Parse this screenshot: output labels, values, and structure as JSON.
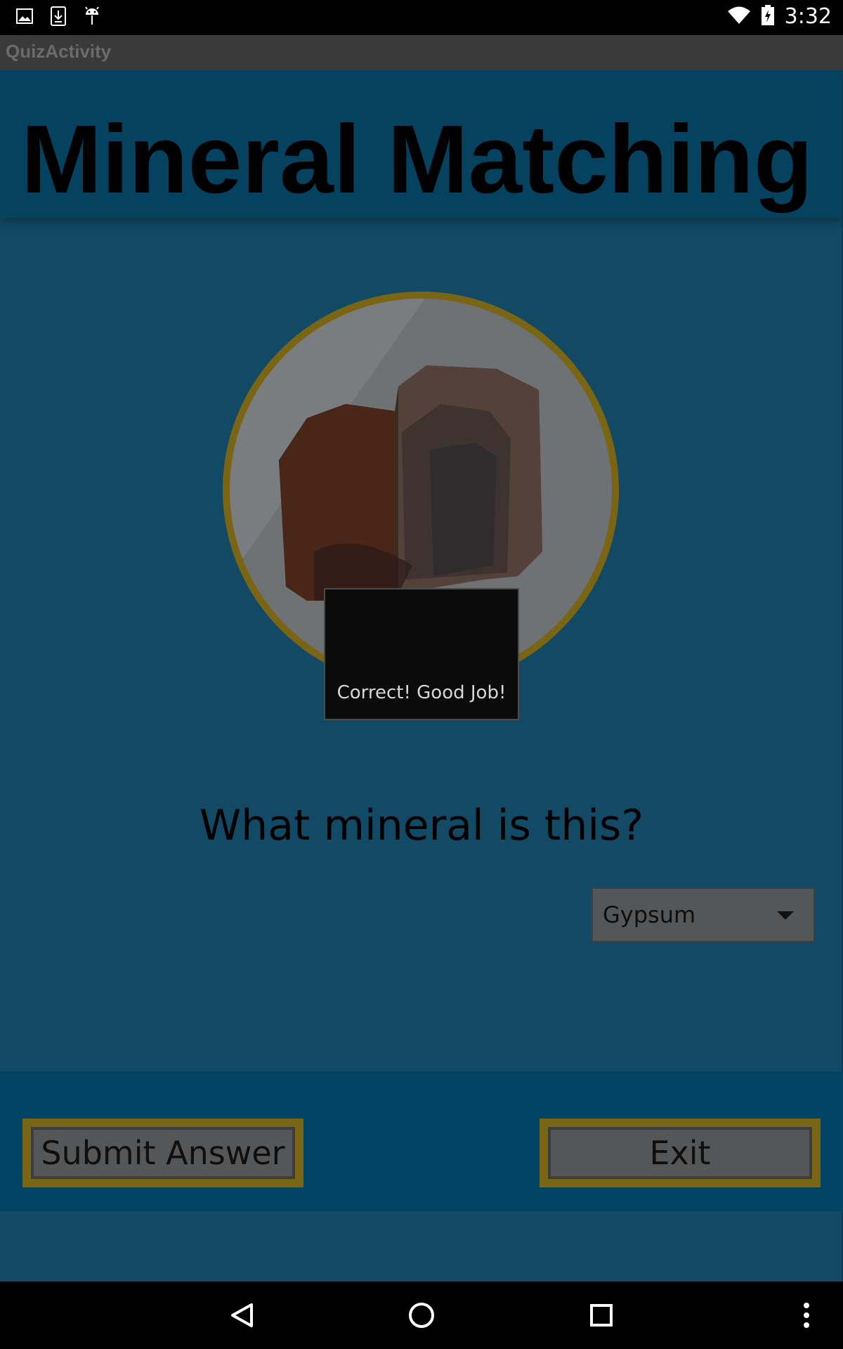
{
  "status_bar": {
    "time": "3:32",
    "left_icons": [
      "image-icon",
      "download-icon",
      "android-icon"
    ],
    "right_icons": [
      "wifi-icon",
      "battery-charging-icon"
    ]
  },
  "title_bar": {
    "title": "QuizActivity"
  },
  "app": {
    "heading": "Mineral Matching",
    "question": "What mineral is this?",
    "answer_select": {
      "selected": "Gypsum"
    },
    "submit_label": "Submit Answer",
    "exit_label": "Exit",
    "toast": "Correct! Good Job!"
  },
  "colors": {
    "app_background": "#124a66",
    "header_background": "#05425f",
    "button_border": "#7a6514",
    "circle_border": "#7a6514"
  },
  "nav_bar": {
    "icons": [
      "back-icon",
      "home-icon",
      "recents-icon",
      "overflow-menu-icon"
    ]
  }
}
